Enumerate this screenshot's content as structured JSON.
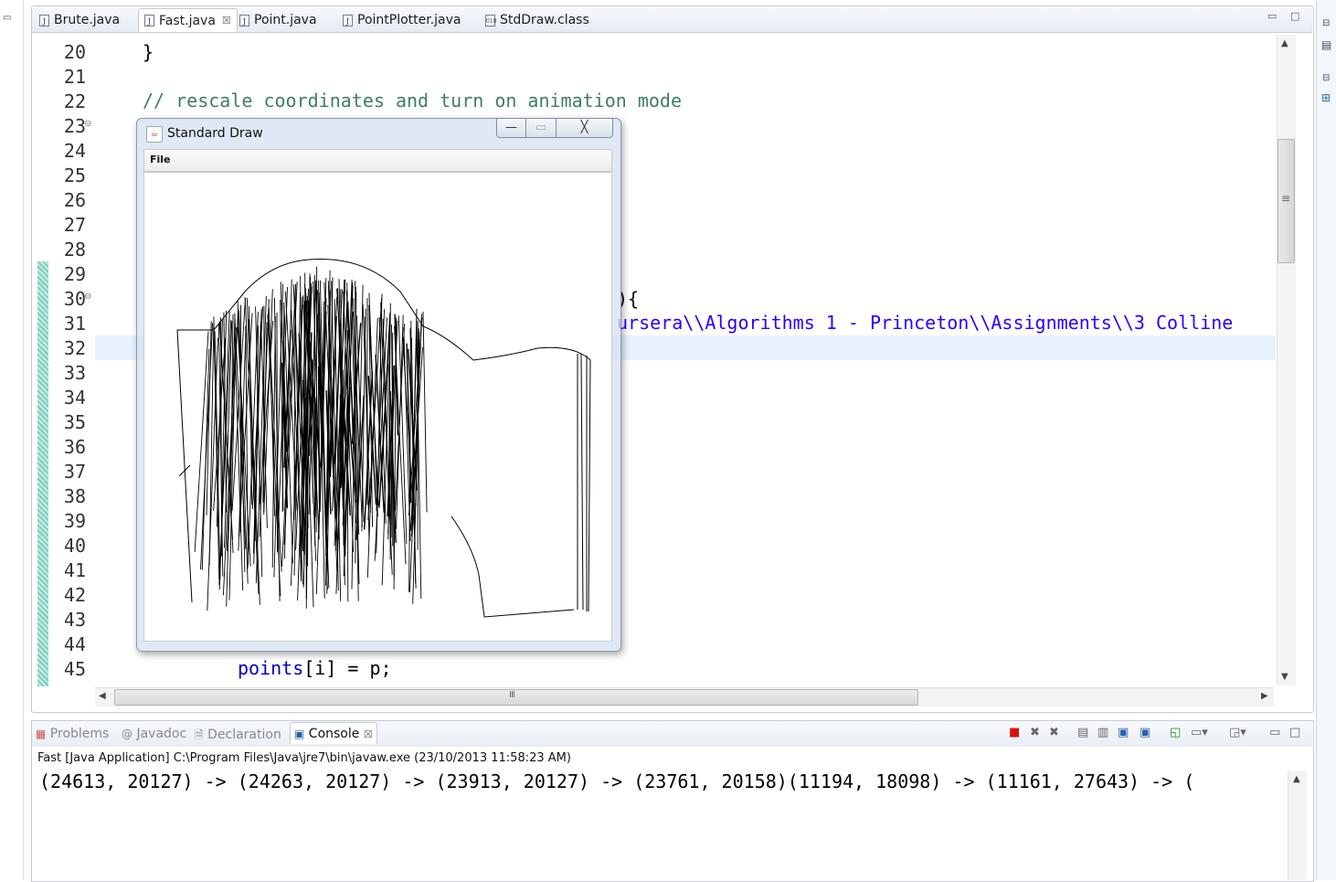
{
  "tabs": [
    {
      "label": "Brute.java",
      "icon": "java-file-icon"
    },
    {
      "label": "Fast.java",
      "icon": "java-file-icon",
      "active": true,
      "close": "☒"
    },
    {
      "label": "Point.java",
      "icon": "java-file-icon"
    },
    {
      "label": "PointPlotter.java",
      "icon": "java-file-icon"
    },
    {
      "label": "StdDraw.class",
      "icon": "class-file-icon"
    }
  ],
  "editor": {
    "line_numbers": [
      "20",
      "21",
      "22",
      "23",
      "24",
      "25",
      "26",
      "27",
      "28",
      "29",
      "30",
      "31",
      "32",
      "33",
      "34",
      "35",
      "36",
      "37",
      "38",
      "39",
      "40",
      "41",
      "42",
      "43",
      "44",
      "45"
    ],
    "lines": {
      "l20": "}",
      "l22": "// rescale coordinates and turn on animation mode",
      "l30_tail": "){",
      "l31_tail": "ursera\\\\Algorithms 1 - Princeton\\\\Assignments\\\\3 Colline",
      "l45_var": "points",
      "l45_rest": "[i] = p;"
    },
    "hscroll_grip": "III",
    "vscroll_grip": "≡"
  },
  "std_draw": {
    "title": "Standard Draw",
    "menu_file": "File",
    "btn_minimize": "—",
    "btn_maximize": "▭",
    "btn_close": "╳"
  },
  "console": {
    "tabs": [
      {
        "label": "Problems",
        "icon": "problems-icon"
      },
      {
        "label": "Javadoc",
        "icon": "javadoc-icon"
      },
      {
        "label": "Declaration",
        "icon": "declaration-icon"
      },
      {
        "label": "Console",
        "icon": "console-icon",
        "active": true,
        "close": "☒"
      }
    ],
    "info": "Fast [Java Application] C:\\Program Files\\Java\\jre7\\bin\\javaw.exe (23/10/2013 11:58:23 AM)",
    "output": "(24613, 20127) -> (24263, 20127) -> (23913, 20127) -> (23761, 20158)(11194, 18098) -> (11161, 27643) -> ("
  }
}
